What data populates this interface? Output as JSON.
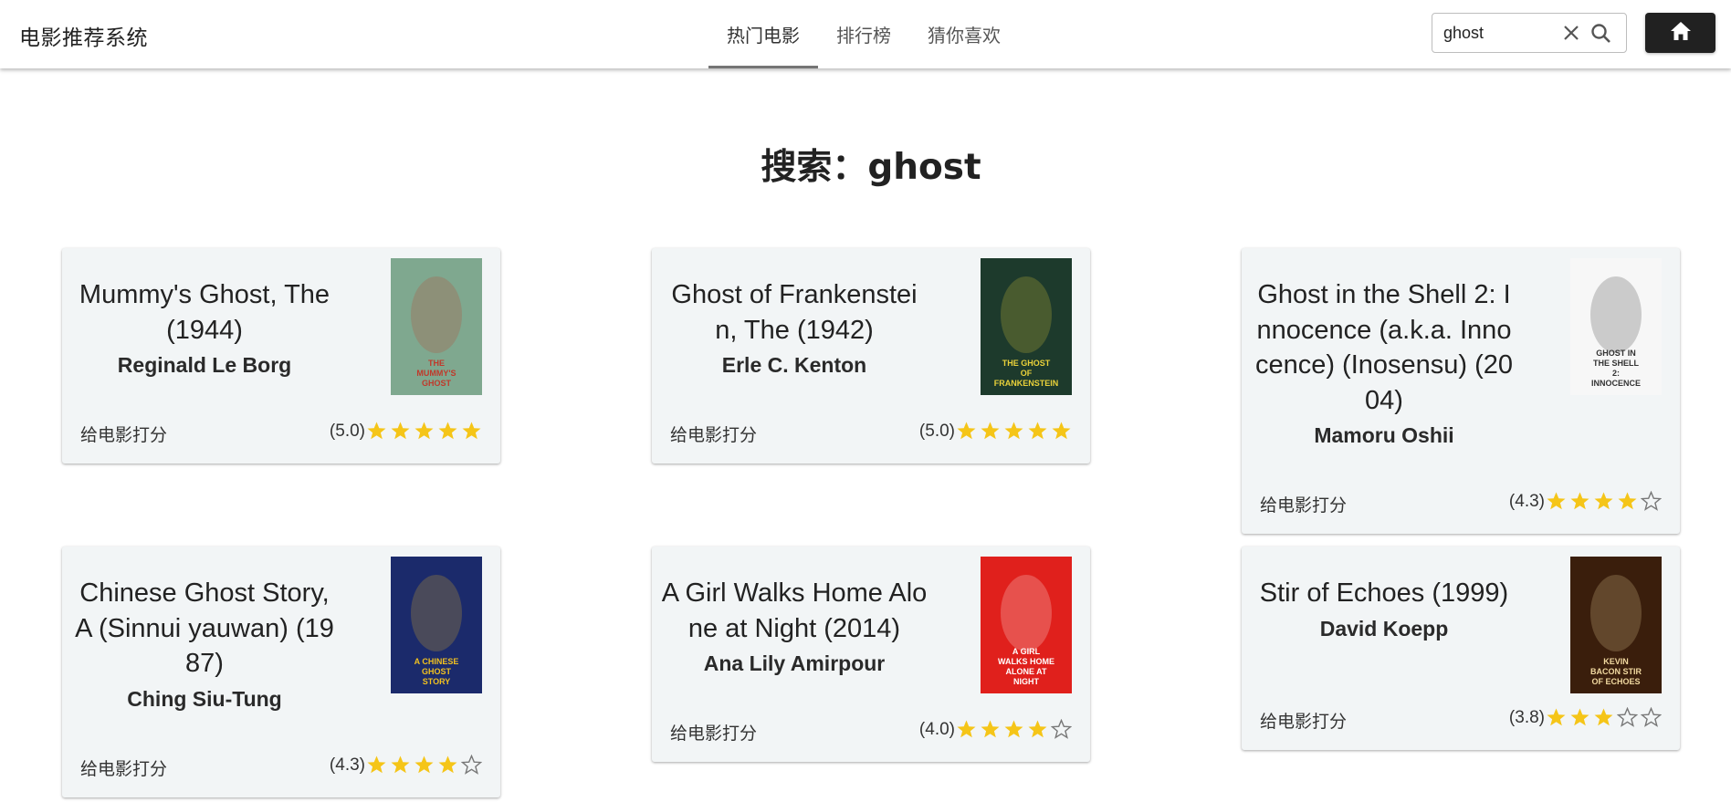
{
  "app": {
    "title": "电影推荐系统"
  },
  "nav": {
    "tabs": [
      {
        "label": "热门电影",
        "active": true
      },
      {
        "label": "排行榜",
        "active": false
      },
      {
        "label": "猜你喜欢",
        "active": false
      }
    ]
  },
  "search": {
    "value": "ghost",
    "clear_icon": "close-icon",
    "search_icon": "search-icon"
  },
  "home": {
    "icon": "home-icon",
    "color": "#212121"
  },
  "heading": {
    "text": "搜索：ghost"
  },
  "colors": {
    "star": "#f5c518",
    "star_empty": "#777777",
    "accent": "#757575"
  },
  "movies": [
    {
      "title": "Mummy's Ghost, The (1944)",
      "director": "Reginald Le Borg",
      "rate_label": "给电影打分",
      "rating_text": "(5.0)",
      "stars": 5
    },
    {
      "title": "Ghost of Frankenstein, The (1942)",
      "director": "Erle C. Kenton",
      "rate_label": "给电影打分",
      "rating_text": "(5.0)",
      "stars": 5
    },
    {
      "title": "Ghost in the Shell 2: Innocence (a.k.a. Innocence) (Inosensu) (2004)",
      "director": "Mamoru Oshii",
      "rate_label": "给电影打分",
      "rating_text": "(4.3)",
      "stars": 4
    },
    {
      "title": "Chinese Ghost Story, A (Sinnui yauwan) (1987)",
      "director": "Ching Siu-Tung",
      "rate_label": "给电影打分",
      "rating_text": "(4.3)",
      "stars": 4
    },
    {
      "title": "A Girl Walks Home Alone at Night (2014)",
      "director": "Ana Lily Amirpour",
      "rate_label": "给电影打分",
      "rating_text": "(4.0)",
      "stars": 4
    },
    {
      "title": "Stir of Echoes (1999)",
      "director": "David Koepp",
      "rate_label": "给电影打分",
      "rating_text": "(3.8)",
      "stars": 3
    }
  ],
  "posters": [
    {
      "text": "THE MUMMY'S GHOST",
      "bg": "#7fa88f",
      "fg": "#c0392b"
    },
    {
      "text": "THE GHOST OF FRANKENSTEIN",
      "bg": "#1d3a2c",
      "fg": "#e9d13a"
    },
    {
      "text": "GHOST IN THE SHELL 2: INNOCENCE",
      "bg": "#f7f7f7",
      "fg": "#333333"
    },
    {
      "text": "A CHINESE GHOST STORY",
      "bg": "#1b2a6b",
      "fg": "#f0c020"
    },
    {
      "text": "A GIRL WALKS HOME ALONE AT NIGHT",
      "bg": "#e0201c",
      "fg": "#ffffff"
    },
    {
      "text": "KEVIN BACON STIR OF ECHOES",
      "bg": "#3a1e0c",
      "fg": "#f1d9a0"
    }
  ]
}
